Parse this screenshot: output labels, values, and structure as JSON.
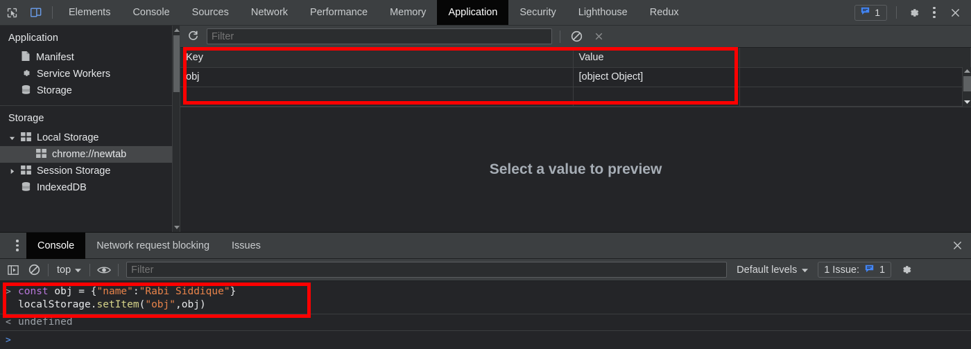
{
  "topbar": {
    "inspect_icon": "inspect-cursor-icon",
    "device_icon": "device-toolbar-icon",
    "tabs": [
      {
        "label": "Elements",
        "active": false
      },
      {
        "label": "Console",
        "active": false
      },
      {
        "label": "Sources",
        "active": false
      },
      {
        "label": "Network",
        "active": false
      },
      {
        "label": "Performance",
        "active": false
      },
      {
        "label": "Memory",
        "active": false
      },
      {
        "label": "Application",
        "active": true
      },
      {
        "label": "Security",
        "active": false
      },
      {
        "label": "Lighthouse",
        "active": false
      },
      {
        "label": "Redux",
        "active": false
      }
    ],
    "issue_badge_count": "1",
    "settings_icon": "gear-icon",
    "more_icon": "vertical-dots-icon",
    "close_icon": "close-icon"
  },
  "sidebar": {
    "application_title": "Application",
    "application_items": [
      {
        "label": "Manifest",
        "icon": "manifest-document-icon"
      },
      {
        "label": "Service Workers",
        "icon": "gear-icon"
      },
      {
        "label": "Storage",
        "icon": "database-icon"
      }
    ],
    "storage_title": "Storage",
    "storage_items": [
      {
        "label": "Local Storage",
        "icon": "table-grid-icon",
        "twisty": "expanded",
        "selected": false,
        "child": false
      },
      {
        "label": "chrome://newtab",
        "icon": "table-grid-icon",
        "twisty": "none",
        "selected": true,
        "child": true
      },
      {
        "label": "Session Storage",
        "icon": "table-grid-icon",
        "twisty": "collapsed",
        "selected": false,
        "child": false
      },
      {
        "label": "IndexedDB",
        "icon": "database-icon",
        "twisty": "none",
        "selected": false,
        "child": false
      }
    ]
  },
  "storage_panel": {
    "refresh_icon": "refresh-icon",
    "filter_placeholder": "Filter",
    "filter_value": "",
    "clear_all_icon": "clear-all-block-icon",
    "delete_selected_icon": "delete-x-icon",
    "table": {
      "columns": [
        "Key",
        "Value"
      ],
      "rows": [
        {
          "key": "obj",
          "value": "[object Object]"
        }
      ]
    },
    "preview_placeholder": "Select a value to preview"
  },
  "drawer": {
    "tabs": [
      {
        "label": "Console",
        "active": true
      },
      {
        "label": "Network request blocking",
        "active": false
      },
      {
        "label": "Issues",
        "active": false
      }
    ],
    "more_tabs_icon": "vertical-dots-icon",
    "close_icon": "close-icon",
    "toolbar": {
      "sidebar_toggle_icon": "console-sidebar-icon",
      "clear_console_icon": "clear-console-block-icon",
      "context_label": "top",
      "context_caret": "chevron-down-icon",
      "eye_icon": "live-expression-eye-icon",
      "filter_placeholder": "Filter",
      "filter_value": "",
      "levels_label": "Default levels",
      "levels_caret": "chevron-down-icon",
      "issues_label": "1 Issue:",
      "issues_count": "1",
      "settings_icon": "gear-icon"
    },
    "console": {
      "input_prompt": ">",
      "input_line1": {
        "kw": "const",
        "name": " obj = {",
        "str_key": "\"name\"",
        "colon": ":",
        "str_val": "\"Rabi Siddique\"",
        "close": "}"
      },
      "input_line2": {
        "obj": "localStorage",
        "dot": ".",
        "fn": "setItem",
        "open": "(",
        "arg_str": "\"obj\"",
        "comma": ",",
        "arg2": "obj",
        "close": ")"
      },
      "result_prompt": "<",
      "result_text": "undefined",
      "next_prompt": ">"
    }
  },
  "annotations": {
    "storage_table_highlight": "red-highlight-box",
    "console_input_highlight": "red-highlight-box"
  },
  "colors": {
    "accent_blue": "#4285f4",
    "annotation_red": "#ff0000",
    "active_tab_bg": "#060606",
    "toolbar_bg": "#3c3f41",
    "panel_bg": "#242528"
  }
}
